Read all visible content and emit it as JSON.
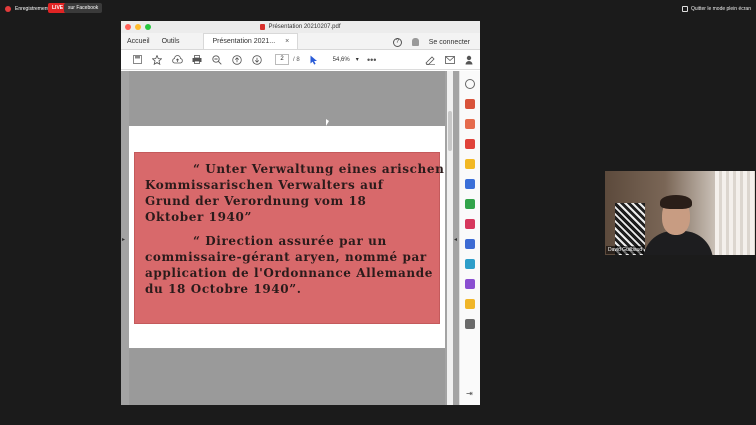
{
  "zoom": {
    "recording_label": "Enregistrement",
    "live_badge": "LIVE",
    "live_destination": "sur Facebook",
    "exit_fullscreen_label": "Quitter le mode plein écran"
  },
  "acrobat": {
    "window_title": "Présentation 20210207.pdf",
    "tabs": {
      "home": "Accueil",
      "tools": "Outils",
      "document": "Présentation 2021...",
      "close": "×"
    },
    "help_icon": "?",
    "sign_in": "Se connecter",
    "toolbar": {
      "current_page": "2",
      "total_pages": "/ 8",
      "zoom_level": "54,6%",
      "more": "•••",
      "zoom_caret": "▾"
    },
    "left_handle": "▸",
    "right_handle": "◂",
    "collapse_icon": "⇥"
  },
  "document": {
    "german_lines": [
      "“ Unter Verwaltung eines arischen",
      "Kommissarischen Verwalters auf",
      "Grund der Verordnung vom 18",
      "Oktober 1940”"
    ],
    "french_lines": [
      "“ Direction assurée par un",
      "commissaire-gérant aryen, nommé par",
      "application de l'Ordonnance Allemande",
      "du 18 Octobre 1940”."
    ]
  },
  "participant": {
    "name": "David Guilbaud"
  },
  "colors": {
    "poster_red": "#d8696b",
    "accent_blue": "#2a5bd7",
    "live_red": "#e02424"
  }
}
